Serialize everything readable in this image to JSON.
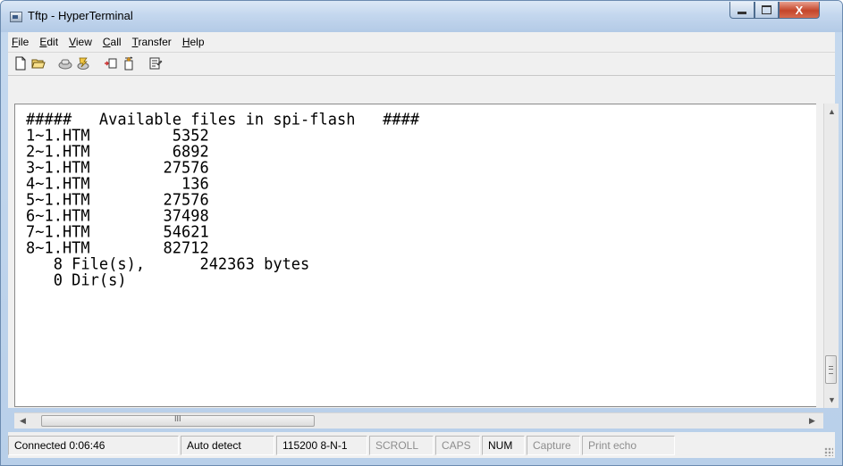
{
  "window": {
    "title": "Tftp - HyperTerminal",
    "controls": {
      "minimize": "minimize-icon",
      "maximize": "maximize-icon",
      "close_glyph": "X"
    }
  },
  "menu": [
    {
      "label": "File",
      "access": "F",
      "rest": "ile"
    },
    {
      "label": "Edit",
      "access": "E",
      "rest": "dit"
    },
    {
      "label": "View",
      "access": "V",
      "rest": "iew"
    },
    {
      "label": "Call",
      "access": "C",
      "rest": "all"
    },
    {
      "label": "Transfer",
      "access": "T",
      "rest": "ransfer"
    },
    {
      "label": "Help",
      "access": "H",
      "rest": "elp"
    }
  ],
  "toolbar": {
    "buttons": [
      "new-connection-icon",
      "open-icon",
      "connect-phone-icon",
      "disconnect-icon",
      "send-file-icon",
      "receive-file-icon",
      "properties-icon"
    ]
  },
  "terminal": {
    "lines": [
      "#####   Available files in spi-flash   ####",
      "1~1.HTM         5352",
      "2~1.HTM         6892",
      "3~1.HTM        27576",
      "4~1.HTM          136",
      "5~1.HTM        27576",
      "6~1.HTM        37498",
      "7~1.HTM        54621",
      "8~1.HTM        82712",
      "   8 File(s),      242363 bytes",
      "   0 Dir(s)"
    ]
  },
  "scrollbars": {
    "h_grip": "III"
  },
  "status": {
    "connected": "Connected 0:06:46",
    "emulation": "Auto detect",
    "settings": "115200 8-N-1",
    "scroll": "SCROLL",
    "caps": "CAPS",
    "num": "NUM",
    "capture": "Capture",
    "print_echo": "Print echo"
  },
  "colors": {
    "accent": "#3a5a86",
    "close": "#c4452a"
  }
}
